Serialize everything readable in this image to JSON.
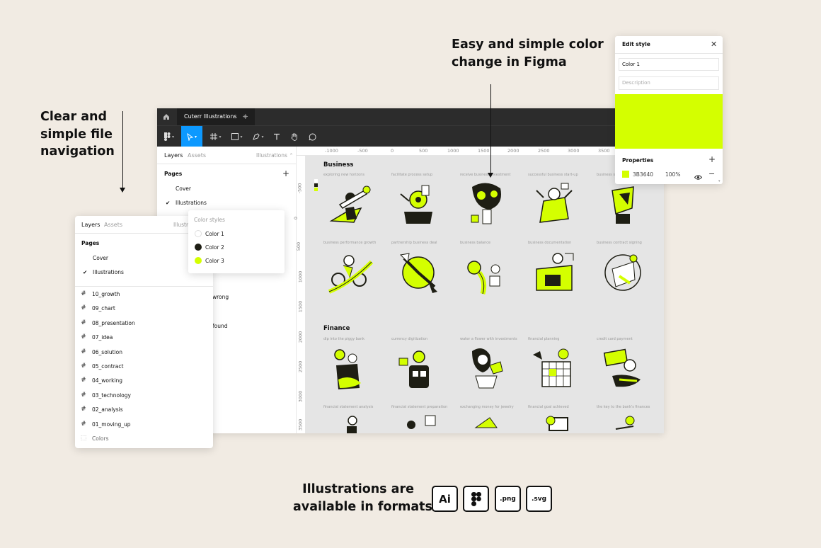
{
  "headlines": {
    "nav": [
      "Clear and",
      "simple file",
      "navigation"
    ],
    "color": [
      "Easy and simple color",
      "change in Figma"
    ],
    "formats": [
      "Illustrations are",
      "available in formats"
    ]
  },
  "window": {
    "tab_title": "Cuterr Illustrations",
    "tab_close": "×",
    "tab_add": "+",
    "left_tabs": {
      "layers": "Layers",
      "assets": "Assets",
      "page_selector": "Illustrations ⌃"
    },
    "pages_label": "Pages",
    "pages": [
      "Cover",
      "Illustrations"
    ],
    "partial_layers": [
      "wrong",
      "found"
    ],
    "ruler_h": [
      "-1000",
      "-500",
      "0",
      "500",
      "1000",
      "1500",
      "2000",
      "2500",
      "3000",
      "3500"
    ],
    "ruler_v": [
      "-500",
      "0",
      "500",
      "1000",
      "1500",
      "2000",
      "2500",
      "3000",
      "3500"
    ]
  },
  "canvas": {
    "sections": [
      {
        "title": "Business",
        "rows": [
          [
            "exploring new horizons",
            "facilitate process setup",
            "receive business investment",
            "successful business start-up",
            "business str"
          ],
          [
            "business performance growth",
            "partnership business deal",
            "business balance",
            "business documentation",
            "business contract signing"
          ]
        ]
      },
      {
        "title": "Finance",
        "rows": [
          [
            "dip into the piggy bank",
            "currency digitization",
            "water a flower with investments",
            "financial planning",
            "credit card payment"
          ],
          [
            "financial statement analysis",
            "financial statement preparation",
            "exchanging money for jewelry",
            "financial goal achieved",
            "the key to the bank's finances"
          ]
        ]
      }
    ]
  },
  "layers_card": {
    "tabs": {
      "layers": "Layers",
      "assets": "Assets",
      "page": "Illustra"
    },
    "pages_label": "Pages",
    "pages": [
      "Cover",
      "Illustrations"
    ],
    "frames": [
      "10_growth",
      "09_chart",
      "08_presentation",
      "07_idea",
      "06_solution",
      "05_contract",
      "04_working",
      "03_technology",
      "02_analysis",
      "01_moving_up"
    ],
    "colors_label": "Colors"
  },
  "color_styles": {
    "title": "Color styles",
    "items": [
      {
        "name": "Color 1",
        "color": "#ffffff"
      },
      {
        "name": "Color 2",
        "color": "#1e1e14"
      },
      {
        "name": "Color 3",
        "color": "#d4ff00"
      }
    ]
  },
  "edit_style": {
    "title": "Edit style",
    "name_value": "Color 1",
    "description_placeholder": "Description",
    "swatch_color": "#d4ff00",
    "properties_label": "Properties",
    "hex": "3B3640",
    "opacity": "100%"
  },
  "formats": [
    "Ai",
    ".png",
    ".svg"
  ],
  "colors": {
    "accent": "#d4ff00",
    "dark": "#2c2c2c",
    "selected": "#0d99ff",
    "bg": "#f1ebe3"
  }
}
